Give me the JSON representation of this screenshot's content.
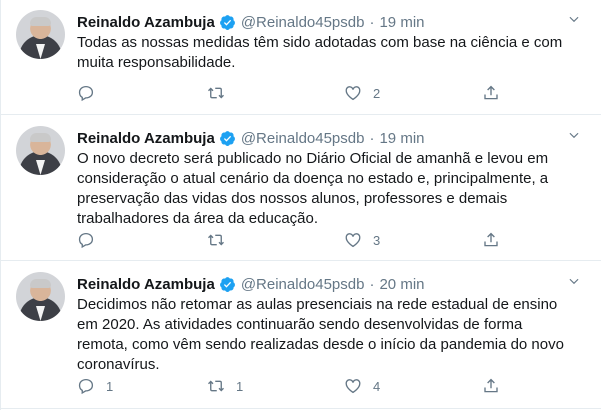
{
  "tweets": [
    {
      "name": "Reinaldo Azambuja",
      "handle": "@Reinaldo45psdb",
      "separator": "·",
      "time": "19 min",
      "text": "Todas as nossas medidas têm sido adotadas com base na ciência e com muita responsabilidade.",
      "reply_count": "",
      "retweet_count": "",
      "like_count": "2"
    },
    {
      "name": "Reinaldo Azambuja",
      "handle": "@Reinaldo45psdb",
      "separator": "·",
      "time": "19 min",
      "text": "O novo decreto será publicado no Diário Oficial de amanhã e levou em consideração o atual cenário da doença no estado e, principalmente, a preservação das vidas dos nossos alunos, professores e demais trabalhadores da área da educação.",
      "reply_count": "",
      "retweet_count": "",
      "like_count": "3"
    },
    {
      "name": "Reinaldo Azambuja",
      "handle": "@Reinaldo45psdb",
      "separator": "·",
      "time": "20 min",
      "text": "Decidimos não retomar as aulas presenciais na rede estadual de ensino em 2020. As atividades continuarão sendo desenvolvidas de forma remota, como vêm sendo realizadas desde o início da pandemia do novo coronavírus.",
      "reply_count": "1",
      "retweet_count": "1",
      "like_count": "4"
    }
  ],
  "icons": {
    "verified": "verified-badge-icon",
    "caret": "chevron-down-icon",
    "reply": "reply-icon",
    "retweet": "retweet-icon",
    "like": "heart-icon",
    "share": "share-icon"
  },
  "colors": {
    "accent": "#1da1f2",
    "text": "#14171a",
    "muted": "#657786",
    "border": "#e6ecf0"
  }
}
